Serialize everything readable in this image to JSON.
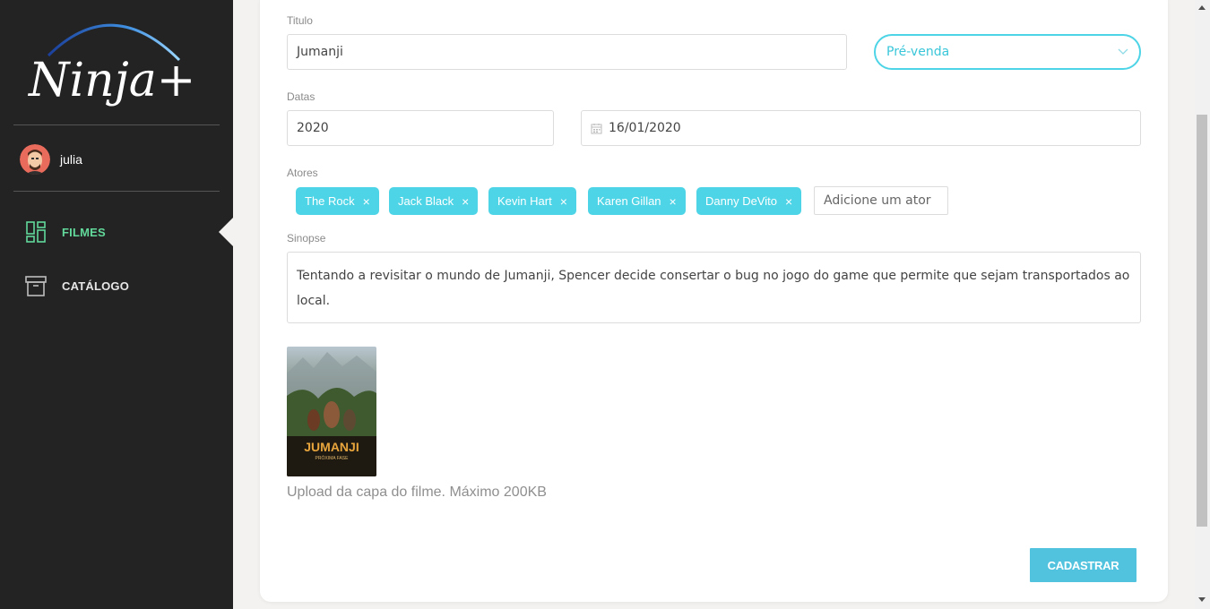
{
  "sidebar": {
    "logo_text": "Ninja+",
    "user": {
      "name": "julia"
    },
    "nav": [
      {
        "label": "FILMES",
        "icon": "dashboard-icon",
        "active": true
      },
      {
        "label": "CATÁLOGO",
        "icon": "archive-icon",
        "active": false
      }
    ]
  },
  "form": {
    "titulo": {
      "label": "Titulo",
      "value": "Jumanji"
    },
    "status": {
      "value": "Pré-venda"
    },
    "datas": {
      "label": "Datas",
      "year": "2020",
      "release_date": "16/01/2020"
    },
    "atores": {
      "label": "Atores",
      "tags": [
        "The Rock",
        "Jack Black",
        "Kevin Hart",
        "Karen Gillan",
        "Danny DeVito"
      ],
      "remove_glyph": "×",
      "placeholder": "Adicione um ator"
    },
    "sinopse": {
      "label": "Sinopse",
      "value": "Tentando a revisitar o mundo de Jumanji, Spencer decide consertar o bug no jogo do game que permite que sejam transportados ao local."
    },
    "upload": {
      "text": "Upload da capa do filme. Máximo 200KB",
      "poster_title": "JUMANJI",
      "poster_subtitle": "PRÓXIMA FASE"
    },
    "submit_label": "CADASTRAR"
  },
  "colors": {
    "sidebar_bg": "#232323",
    "accent_cyan": "#4dd4e6",
    "accent_green": "#62d99b",
    "button": "#52c3df"
  }
}
